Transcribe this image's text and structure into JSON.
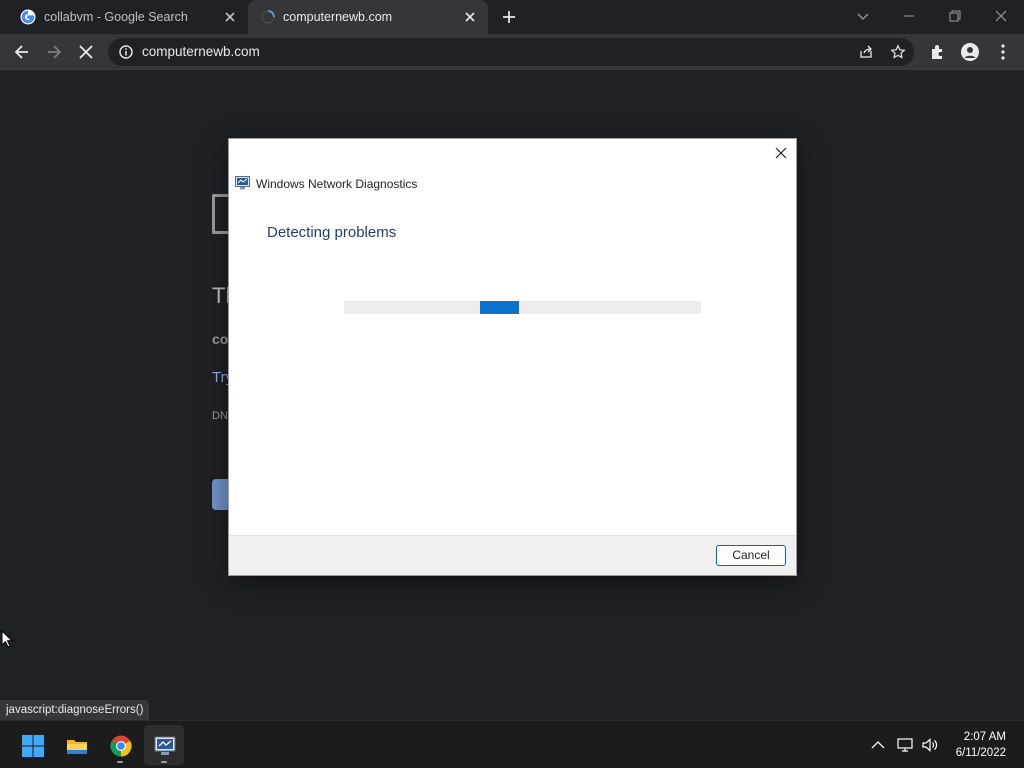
{
  "browser": {
    "tabs": [
      {
        "title": "collabvm - Google Search",
        "favicon": "google-icon",
        "active": false
      },
      {
        "title": "computernewb.com",
        "favicon": "loading-spinner-icon",
        "active": true
      }
    ],
    "url": "computernewb.com"
  },
  "page": {
    "heading": "Tl",
    "bold_text": "co",
    "link_text": "Try",
    "code_text": "DN"
  },
  "dialog": {
    "app_title": "Windows Network Diagnostics",
    "heading": "Detecting problems",
    "progress": 0.38,
    "cancel_label": "Cancel"
  },
  "statusbar": {
    "text": "javascript:diagnoseErrors()"
  },
  "taskbar": {
    "apps": [
      "start-icon",
      "file-explorer-icon",
      "chrome-icon",
      "network-diagnostics-icon"
    ],
    "time": "2:07 AM",
    "date": "6/11/2022"
  },
  "colors": {
    "accent": "#0a73cf",
    "dialog_heading": "#1e3e6e"
  }
}
